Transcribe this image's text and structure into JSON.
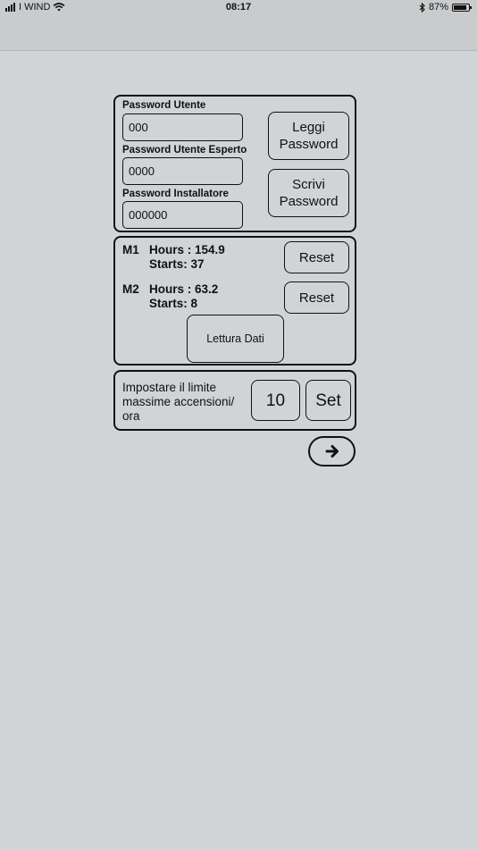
{
  "status_bar": {
    "carrier": "WIND",
    "time": "08:17",
    "battery_percent": "87%",
    "battery_level": 0.87
  },
  "passwords": {
    "user_label": "Password Utente",
    "user_value": "000",
    "expert_label": "Password Utente Esperto",
    "expert_value": "0000",
    "installer_label": "Password Installatore",
    "installer_value": "000000",
    "read_button": "Leggi\nPassword",
    "write_button": "Scrivi\nPassword"
  },
  "motors": [
    {
      "id": "M1",
      "hours": "Hours : 154.9",
      "starts": "Starts: 37",
      "reset_label": "Reset"
    },
    {
      "id": "M2",
      "hours": "Hours : 63.2",
      "starts": "Starts: 8",
      "reset_label": "Reset"
    }
  ],
  "read_data_button": "Lettura Dati",
  "limit": {
    "label": "Impostare il limite\nmassime accensioni/\nora",
    "value": "10",
    "set_button": "Set"
  },
  "icons": {
    "next": "arrow-right-icon",
    "wifi": "wifi-icon",
    "bluetooth": "bluetooth-icon"
  }
}
